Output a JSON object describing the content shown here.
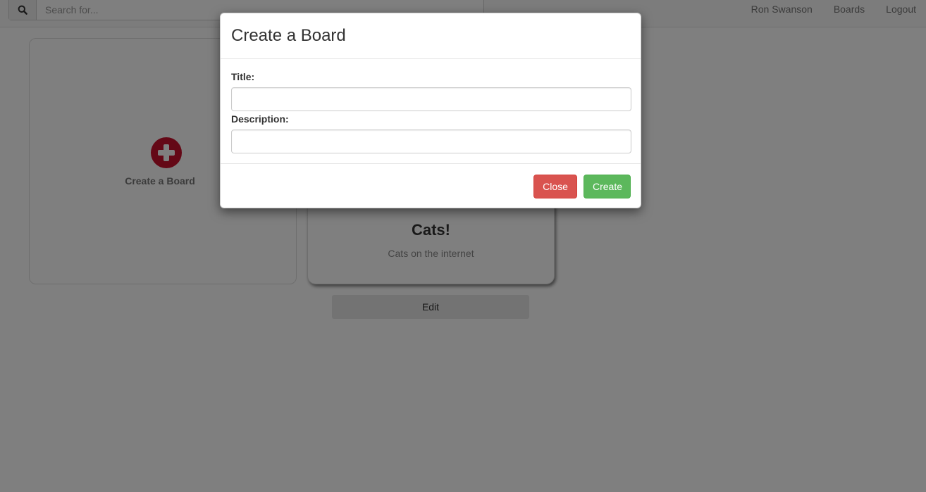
{
  "navbar": {
    "search_placeholder": "Search for...",
    "links": [
      "Ron Swanson",
      "Boards",
      "Logout"
    ]
  },
  "create_card": {
    "label": "Create a Board",
    "icon": "plus-circle-icon",
    "icon_color": "#c9102c"
  },
  "board_card": {
    "title": "Cats!",
    "description": "Cats on the internet",
    "edit_label": "Edit"
  },
  "modal": {
    "title": "Create a Board",
    "title_label": "Title:",
    "title_value": "",
    "description_label": "Description:",
    "description_value": "",
    "close_label": "Close",
    "create_label": "Create",
    "close_color": "#d9534f",
    "create_color": "#5cb85c"
  }
}
